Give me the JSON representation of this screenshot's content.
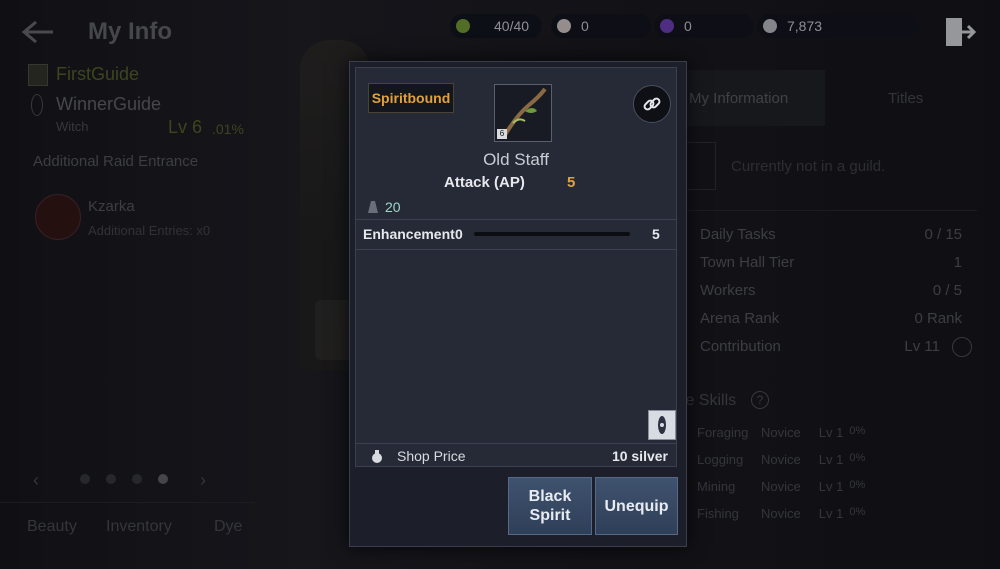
{
  "header": {
    "title": "My Info"
  },
  "resources": [
    {
      "icon": "energy-icon",
      "value": "40/40",
      "color": "#7ea83a"
    },
    {
      "icon": "pearl-icon",
      "value": "0",
      "color": "#e3d9d6"
    },
    {
      "icon": "purple-gem-icon",
      "value": "0",
      "color": "#7a45c9"
    },
    {
      "icon": "silver-coin-icon",
      "value": "7,873",
      "color": "#c9cdd6"
    }
  ],
  "profile": {
    "family_name": "FirstGuide",
    "char_name": "WinnerGuide",
    "class_name": "Witch",
    "level": "Lv 6",
    "level_pct": ".01%",
    "raid_label": "Additional Raid Entrance",
    "boss_name": "Kzarka",
    "boss_entries": "Additional Entries: x0"
  },
  "bottom_tabs": [
    "Beauty",
    "Inventory",
    "Dye"
  ],
  "right_tabs": [
    "My Information",
    "Titles"
  ],
  "guild_text": "Currently not in a guild.",
  "stats": [
    {
      "label": "Daily Tasks",
      "value": "0 / 15"
    },
    {
      "label": "Town Hall Tier",
      "value": "1"
    },
    {
      "label": "Workers",
      "value": "0 / 5"
    },
    {
      "label": "Arena Rank",
      "value": "0 Rank"
    },
    {
      "label": "Contribution",
      "value": "Lv 11"
    }
  ],
  "life_skills": {
    "title": "Life Skills",
    "title_visible": "fe Skills",
    "rows": [
      {
        "name": "Foraging",
        "rank": "Novice",
        "lv": "Lv 1",
        "pct": "0%"
      },
      {
        "name": "Logging",
        "rank": "Novice",
        "lv": "Lv 1",
        "pct": "0%"
      },
      {
        "name": "Mining",
        "rank": "Novice",
        "lv": "Lv 1",
        "pct": "0%"
      },
      {
        "name": "Fishing",
        "rank": "Novice",
        "lv": "Lv 1",
        "pct": "0%"
      }
    ]
  },
  "item": {
    "badge": "Spiritbound",
    "name": "Old Staff",
    "stat_label": "Attack (AP)",
    "stat_value": "5",
    "weight": "20",
    "enhancement_label": "Enhancement",
    "enhancement_current": "0",
    "enhancement_max": "5",
    "enhancement_progress": 0,
    "shop_label": "Shop Price",
    "shop_value": "10 silver",
    "lock_level": "6"
  },
  "buttons": {
    "black_spirit_line1": "Black",
    "black_spirit_line2": "Spirit",
    "unequip": "Unequip"
  }
}
